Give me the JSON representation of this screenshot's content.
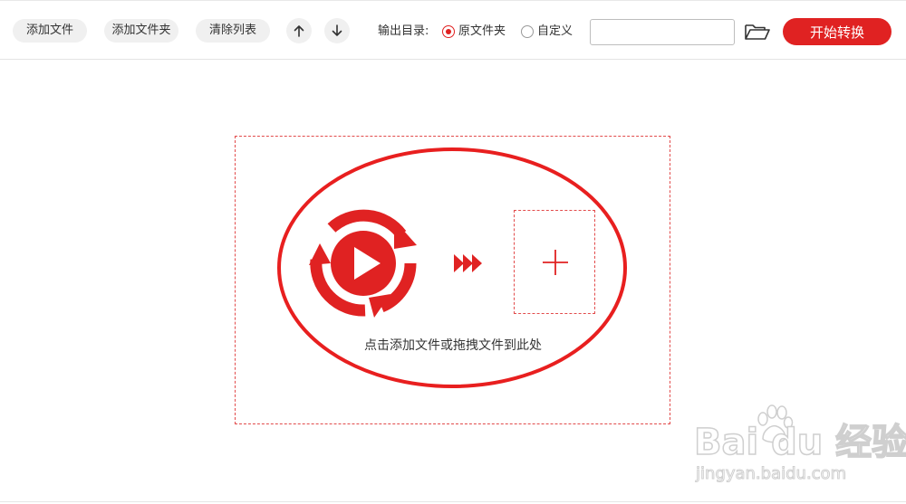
{
  "toolbar": {
    "add_file_label": "添加文件",
    "add_folder_label": "添加文件夹",
    "clear_list_label": "清除列表",
    "output_dir_label": "输出目录:",
    "radio_original_label": "原文件夹",
    "radio_custom_label": "自定义",
    "selected_output": "原文件夹",
    "path_value": "",
    "start_label": "开始转换"
  },
  "drop_zone": {
    "hint": "点击添加文件或拖拽文件到此处"
  },
  "watermark": {
    "main": "Bai du 经验",
    "sub": "jingyan.baidu.com"
  },
  "colors": {
    "accent": "#e02222",
    "dashed_border": "#e24b4b",
    "button_bg": "#f0f0f0"
  },
  "icons": {
    "move_up": "arrow-up-icon",
    "move_down": "arrow-down-icon",
    "browse": "folder-open-icon",
    "logo": "video-convert-logo-icon",
    "forward": "triple-chevron-right-icon",
    "add": "plus-icon"
  }
}
